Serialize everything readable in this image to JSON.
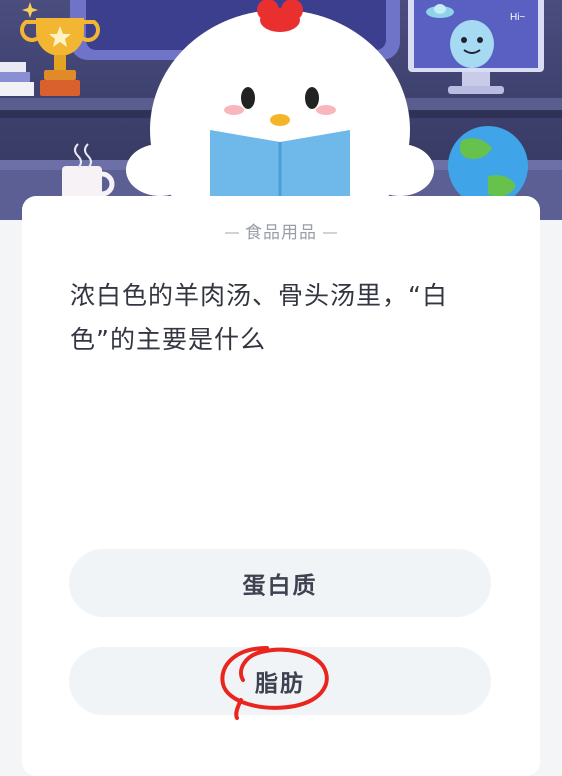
{
  "quiz": {
    "category": "食品用品",
    "question": "浓白色的羊肉汤、骨头汤里，“白色”的主要是什么",
    "options": [
      {
        "label": "蛋白质"
      },
      {
        "label": "脂肪"
      }
    ],
    "hero_speech": "Hi~",
    "highlight_color": "#e8251e"
  }
}
